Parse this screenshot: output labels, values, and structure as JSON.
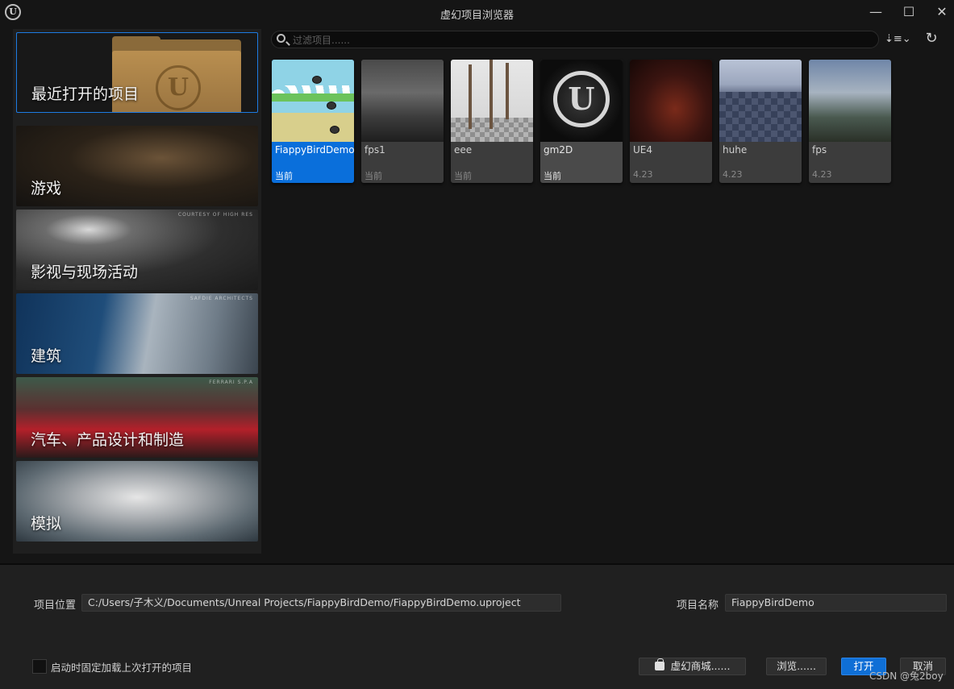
{
  "window": {
    "title": "虚幻项目浏览器",
    "logo_icon": "unreal-logo-icon",
    "minimize_glyph": "—",
    "maximize_glyph": "☐",
    "close_glyph": "✕"
  },
  "categories": [
    {
      "label": "最近打开的项目",
      "credit": "",
      "selected": true
    },
    {
      "label": "游戏",
      "credit": ""
    },
    {
      "label": "影视与现场活动",
      "credit": "COURTESY OF HIGH RES"
    },
    {
      "label": "建筑",
      "credit": "SAFDIE ARCHITECTS"
    },
    {
      "label": "汽车、产品设计和制造",
      "credit": "FERRARI S.P.A"
    },
    {
      "label": "模拟",
      "credit": ""
    }
  ],
  "search": {
    "placeholder": "过滤项目......",
    "value": ""
  },
  "toolbar": {
    "sort_glyph": "⇣≡⌄",
    "refresh_glyph": "↻"
  },
  "projects": [
    {
      "name": "FiappyBirdDemo",
      "version": "当前",
      "selected": true
    },
    {
      "name": "fps1",
      "version": "当前"
    },
    {
      "name": "eee",
      "version": "当前"
    },
    {
      "name": "gm2D",
      "version": "当前"
    },
    {
      "name": "UE4",
      "version": "4.23"
    },
    {
      "name": "huhe",
      "version": "4.23"
    },
    {
      "name": "fps",
      "version": "4.23"
    }
  ],
  "thumb_marks": {
    "gm2d_logo": "U",
    "folder_emblem": "U"
  },
  "bottom": {
    "location_label": "项目位置",
    "location_value": "C:/Users/子木义/Documents/Unreal Projects/FiappyBirdDemo/FiappyBirdDemo.uproject",
    "name_label": "项目名称",
    "name_value": "FiappyBirdDemo",
    "autoload_label": "启动时固定加载上次打开的项目",
    "autoload_checked": false,
    "store_button": "虚幻商城......",
    "browse_button": "浏览......",
    "open_button": "打开",
    "cancel_button": "取消"
  },
  "watermark": "CSDN @兔2boy",
  "colors": {
    "accent": "#0f6fd6",
    "background": "#151515",
    "panel": "#202020"
  }
}
